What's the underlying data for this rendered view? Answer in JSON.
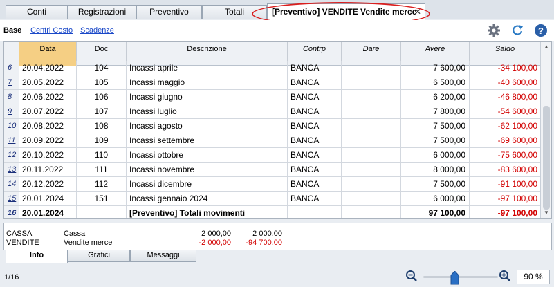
{
  "top_tabs": [
    {
      "label": "Conti"
    },
    {
      "label": "Registrazioni"
    },
    {
      "label": "Preventivo"
    },
    {
      "label": "Totali"
    },
    {
      "label": "[Preventivo] VENDITE Vendite merce"
    }
  ],
  "close_glyph": "✕",
  "sub_tabs": {
    "base": "Base",
    "centri": "Centri Costo",
    "scadenze": "Scadenze"
  },
  "toolbar_icons": [
    "gear-icon",
    "refresh-icon",
    "help-icon"
  ],
  "columns": {
    "data": "Data",
    "doc": "Doc",
    "descrizione": "Descrizione",
    "contrp": "Contrp",
    "dare": "Dare",
    "avere": "Avere",
    "saldo": "Saldo"
  },
  "rows": [
    {
      "num": "6",
      "date": "20.04.2022",
      "doc": "104",
      "desc": "Incassi aprile",
      "contrp": "BANCA",
      "dare": "",
      "avere": "7 600,00",
      "saldo": "-34 100,00"
    },
    {
      "num": "7",
      "date": "20.05.2022",
      "doc": "105",
      "desc": "Incassi maggio",
      "contrp": "BANCA",
      "dare": "",
      "avere": "6 500,00",
      "saldo": "-40 600,00"
    },
    {
      "num": "8",
      "date": "20.06.2022",
      "doc": "106",
      "desc": "Incassi giugno",
      "contrp": "BANCA",
      "dare": "",
      "avere": "6 200,00",
      "saldo": "-46 800,00"
    },
    {
      "num": "9",
      "date": "20.07.2022",
      "doc": "107",
      "desc": "Incassi luglio",
      "contrp": "BANCA",
      "dare": "",
      "avere": "7 800,00",
      "saldo": "-54 600,00"
    },
    {
      "num": "10",
      "date": "20.08.2022",
      "doc": "108",
      "desc": "Incassi agosto",
      "contrp": "BANCA",
      "dare": "",
      "avere": "7 500,00",
      "saldo": "-62 100,00"
    },
    {
      "num": "11",
      "date": "20.09.2022",
      "doc": "109",
      "desc": "Incassi settembre",
      "contrp": "BANCA",
      "dare": "",
      "avere": "7 500,00",
      "saldo": "-69 600,00"
    },
    {
      "num": "12",
      "date": "20.10.2022",
      "doc": "110",
      "desc": "Incassi ottobre",
      "contrp": "BANCA",
      "dare": "",
      "avere": "6 000,00",
      "saldo": "-75 600,00"
    },
    {
      "num": "13",
      "date": "20.11.2022",
      "doc": "111",
      "desc": "Incassi novembre",
      "contrp": "BANCA",
      "dare": "",
      "avere": "8 000,00",
      "saldo": "-83 600,00"
    },
    {
      "num": "14",
      "date": "20.12.2022",
      "doc": "112",
      "desc": "Incassi dicembre",
      "contrp": "BANCA",
      "dare": "",
      "avere": "7 500,00",
      "saldo": "-91 100,00"
    },
    {
      "num": "15",
      "date": "20.01.2024",
      "doc": "151",
      "desc": "Incassi gennaio 2024",
      "contrp": "BANCA",
      "dare": "",
      "avere": "6 000,00",
      "saldo": "-97 100,00"
    }
  ],
  "total_row": {
    "num": "16",
    "date": "20.01.2024",
    "doc": "",
    "desc": "[Preventivo] Totali movimenti",
    "contrp": "",
    "dare": "",
    "avere": "97 100,00",
    "saldo": "-97 100,00"
  },
  "info_panel": [
    {
      "account": "CASSA",
      "name": "Cassa",
      "v1": "2 000,00",
      "v2": "2 000,00"
    },
    {
      "account": "VENDITE",
      "name": "Vendite merce",
      "v1": "-2 000,00",
      "v2": "-94 700,00"
    }
  ],
  "bottom_tabs": [
    "Info",
    "Grafici",
    "Messaggi"
  ],
  "status": {
    "page": "1/16",
    "zoom": "90  %"
  },
  "colors": {
    "negative": "#d20000",
    "date_header": "#f5cf84",
    "link": "#1a48c8",
    "highlight_ellipse": "#d91e1e"
  }
}
